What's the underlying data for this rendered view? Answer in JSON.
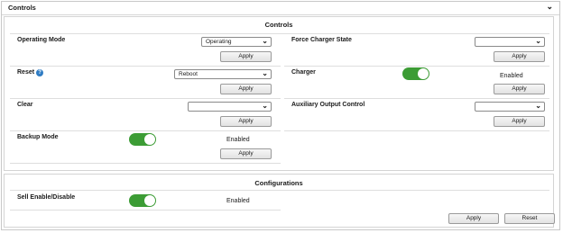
{
  "header": {
    "title": "Controls"
  },
  "controls": {
    "title": "Controls",
    "operating_mode": {
      "label": "Operating Mode",
      "value": "Operating",
      "apply": "Apply"
    },
    "force_charger_state": {
      "label": "Force Charger State",
      "value": "",
      "apply": "Apply"
    },
    "reset": {
      "label": "Reset",
      "value": "Reboot",
      "apply": "Apply"
    },
    "charger": {
      "label": "Charger",
      "status": "Enabled",
      "apply": "Apply"
    },
    "clear": {
      "label": "Clear",
      "value": "",
      "apply": "Apply"
    },
    "auxiliary_output_control": {
      "label": "Auxiliary Output Control",
      "value": "",
      "apply": "Apply"
    },
    "backup_mode": {
      "label": "Backup Mode",
      "status": "Enabled",
      "apply": "Apply"
    }
  },
  "configurations": {
    "title": "Configurations",
    "sell_enable": {
      "label": "Sell Enable/Disable",
      "status": "Enabled"
    },
    "apply": "Apply",
    "reset": "Reset"
  },
  "colors": {
    "toggle_on": "#3c9c35",
    "help_icon": "#2f7cc4"
  }
}
